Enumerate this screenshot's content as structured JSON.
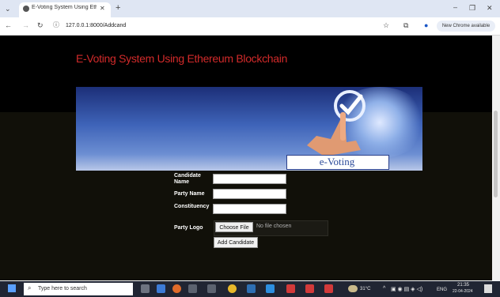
{
  "browser": {
    "tab_title": "E-Voting System Using Ethere...",
    "url": "127.0.0.1:8000/Addcand",
    "new_chrome_label": "New Chrome available"
  },
  "page": {
    "title": "E-Voting System Using Ethereum Blockchain",
    "banner_label": "e-Voting"
  },
  "form": {
    "candidate_label": "Candidate Name",
    "party_label": "Party Name",
    "constituency_label": "Constituency",
    "logo_label": "Party Logo",
    "choose_file": "Choose File",
    "no_file": "No file chosen",
    "submit": "Add Candidate"
  },
  "taskbar": {
    "search_placeholder": "Type here to search",
    "weather": "31°C",
    "lang": "ENG",
    "time": "21:35",
    "date": "22-04-2024"
  }
}
